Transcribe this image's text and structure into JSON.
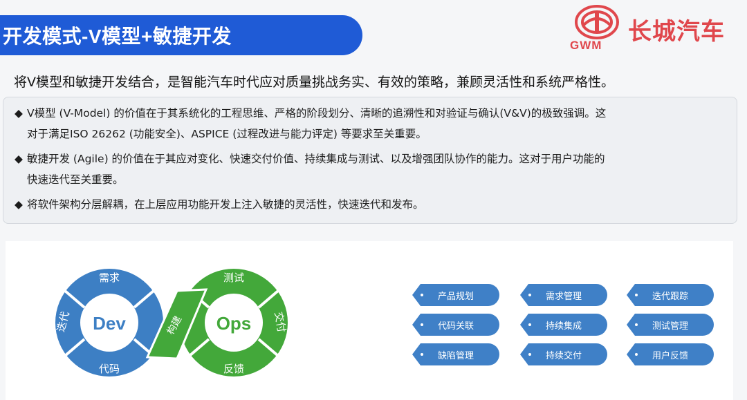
{
  "header": {
    "title": "开发模式-V模型+敏捷开发"
  },
  "logo": {
    "brand_en": "GWM",
    "brand_cn": "长城汽车",
    "color": "#e0474c"
  },
  "intro": "将V模型和敏捷开发结合，是智能汽车时代应对质量挑战务实、有效的策略，兼顾灵活性和系统严格性。",
  "bullets": [
    {
      "marker": "◆",
      "line1": "V模型 (V-Model) 的价值在于其系统化的工程思维、严格的阶段划分、清晰的追溯性和对验证与确认(V&V)的极致强调。这",
      "line2": "对于满足ISO 26262 (功能安全)、ASPICE (过程改进与能力评定) 等要求至关重要。"
    },
    {
      "marker": "◆",
      "line1": "敏捷开发 (Agile) 的价值在于其应对变化、快速交付价值、持续集成与测试、以及增强团队协作的能力。这对于用户功能的",
      "line2": "快速迭代至关重要。"
    },
    {
      "marker": "◆",
      "line1": "将软件架构分层解耦，在上层应用功能开发上注入敏捷的灵活性，快速迭代和发布。",
      "line2": ""
    }
  ],
  "devops": {
    "dev_label": "Dev",
    "ops_label": "Ops",
    "dev_segments": [
      "需求",
      "迭代",
      "代码"
    ],
    "ops_segments": [
      "测试",
      "交付",
      "反馈"
    ],
    "bridge": "构建",
    "dev_color": "#3d7fc4",
    "ops_color": "#43a83a"
  },
  "tags": [
    [
      "产品规划",
      "需求管理",
      "迭代跟踪"
    ],
    [
      "代码关联",
      "持续集成",
      "测试管理"
    ],
    [
      "缺陷管理",
      "持续交付",
      "用户反馈"
    ]
  ]
}
